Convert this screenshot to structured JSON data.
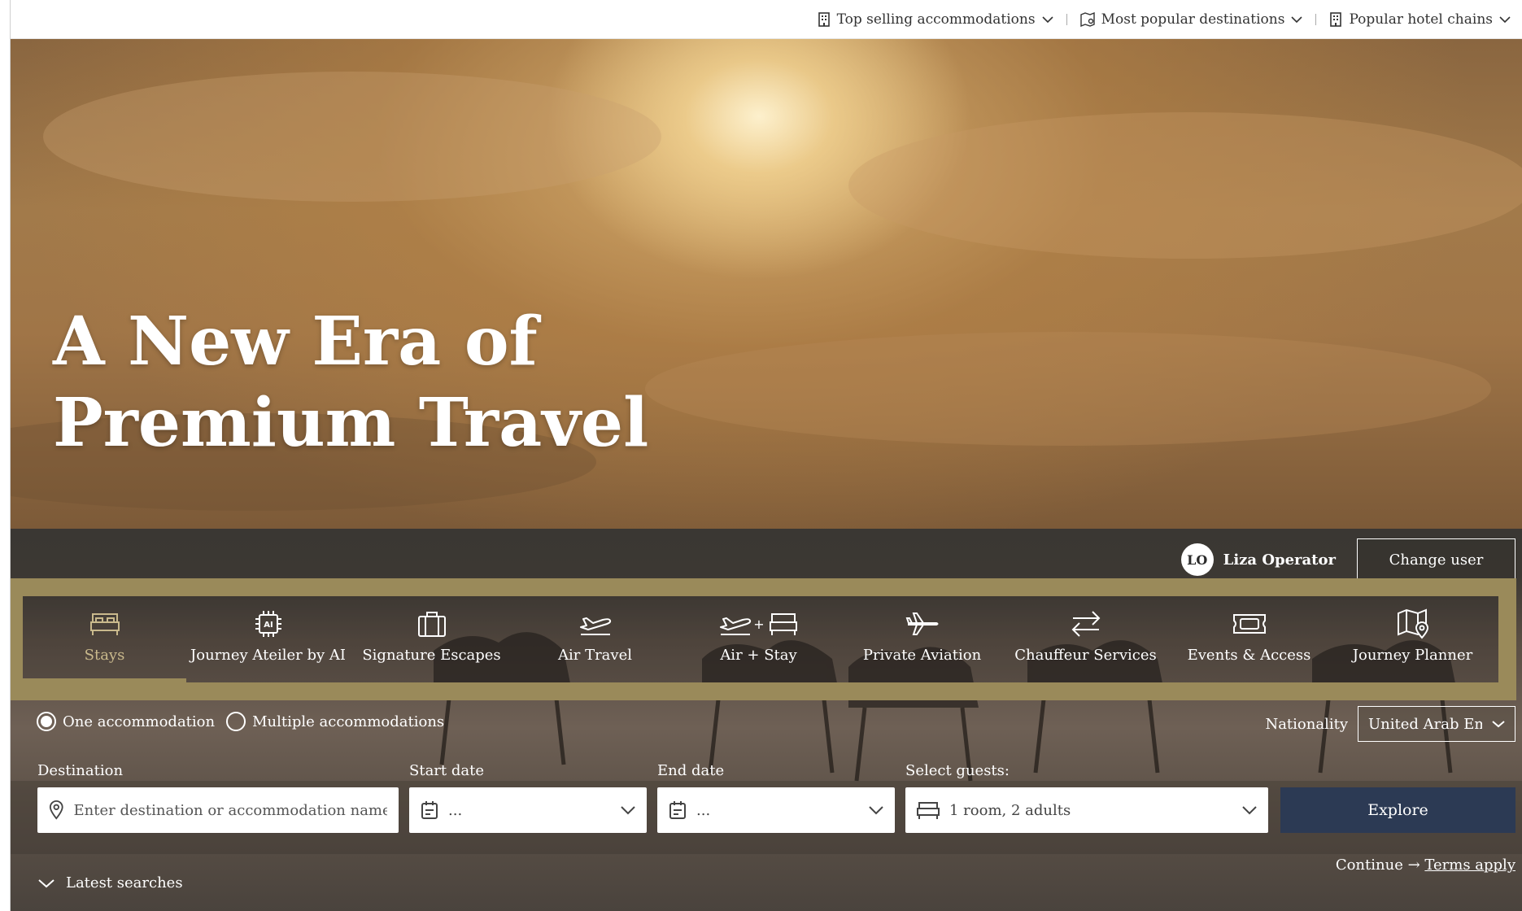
{
  "topbar": {
    "items": [
      {
        "label": "Top selling accommodations",
        "icon": "building-icon"
      },
      {
        "label": "Most popular destinations",
        "icon": "map-pin-icon"
      },
      {
        "label": "Popular hotel chains",
        "icon": "building-icon"
      }
    ]
  },
  "hero": {
    "title_line1": "A New Era of",
    "title_line2": "Premium Travel"
  },
  "user": {
    "initials": "LO",
    "name": "Liza Operator",
    "change_label": "Change user"
  },
  "tabs": [
    {
      "label": "Stays",
      "icon": "bed-icon",
      "active": true
    },
    {
      "label": "Journey Ateiler by AI",
      "icon": "ai-chip-icon",
      "active": false
    },
    {
      "label": "Signature Escapes",
      "icon": "suitcase-icon",
      "active": false
    },
    {
      "label": "Air Travel",
      "icon": "plane-takeoff-icon",
      "active": false
    },
    {
      "label": "Air + Stay",
      "icon": "plane-plus-bed-icon",
      "active": false
    },
    {
      "label": "Private Aviation",
      "icon": "plane-icon",
      "active": false
    },
    {
      "label": "Chauffeur Services",
      "icon": "swap-arrows-icon",
      "active": false
    },
    {
      "label": "Events & Access",
      "icon": "ticket-icon",
      "active": false
    },
    {
      "label": "Journey Planner",
      "icon": "map-icon",
      "active": false
    }
  ],
  "search": {
    "mode_one": "One accommodation",
    "mode_multiple": "Multiple accommodations",
    "nationality_label": "Nationality",
    "nationality_value": "United Arab Emirates",
    "destination_label": "Destination",
    "destination_placeholder": "Enter destination or accommodation name",
    "start_label": "Start date",
    "start_value": "...",
    "end_label": "End date",
    "end_value": "...",
    "guests_label": "Select guests:",
    "guests_value": "1 room, 2 adults",
    "explore_label": "Explore",
    "continue_text": "Continue →",
    "terms_text": "Terms apply",
    "latest_label": "Latest searches"
  },
  "colors": {
    "accent_gold": "#9a8a5a",
    "active_tab_text": "#c9b98c",
    "explore_bg": "#2c3a54"
  }
}
